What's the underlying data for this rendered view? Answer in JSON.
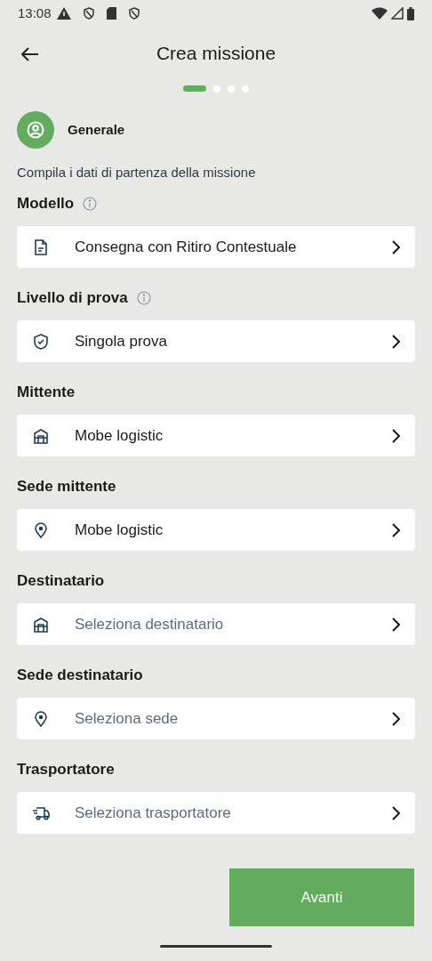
{
  "status_bar": {
    "time": "13:08"
  },
  "header": {
    "title": "Crea missione"
  },
  "steps": [
    {
      "selected": true
    },
    {
      "selected": false
    },
    {
      "selected": false
    },
    {
      "selected": false
    }
  ],
  "section": {
    "title": "Generale"
  },
  "subtitle": "Compila i dati di partenza della missione",
  "fields": [
    {
      "label": "Modello",
      "info": true,
      "kind": "document",
      "value": "Consegna con Ritiro Contestuale"
    },
    {
      "label": "Livello di prova",
      "info": true,
      "kind": "shield",
      "value": "Singola prova"
    },
    {
      "label": "Mittente",
      "info": false,
      "kind": "building",
      "value": "Mobe logistic"
    },
    {
      "label": "Sede mittente",
      "info": false,
      "kind": "pin",
      "value": "Mobe logistic"
    },
    {
      "label": "Destinatario",
      "info": false,
      "kind": "building",
      "placeholder": "Seleziona destinatario"
    },
    {
      "label": "Sede destinatario",
      "info": false,
      "kind": "pin",
      "placeholder": "Seleziona sede"
    },
    {
      "label": "Trasportatore",
      "info": false,
      "kind": "truck",
      "placeholder": "Seleziona trasportatore"
    }
  ],
  "next_button": "Avanti"
}
